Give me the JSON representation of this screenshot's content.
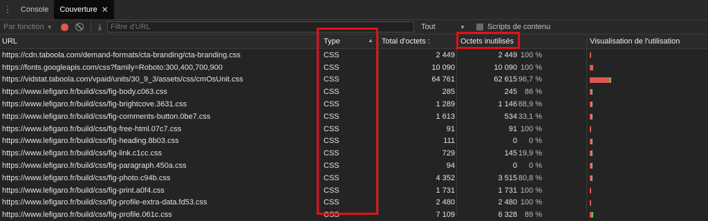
{
  "tabs": [
    {
      "label": "Console",
      "active": false
    },
    {
      "label": "Couverture",
      "active": true
    }
  ],
  "toolbar": {
    "type_select": "Par fonction",
    "filter_placeholder": "Filtre d'URL",
    "scope_select": "Tout",
    "content_scripts_label": "Scripts de contenu"
  },
  "columns": {
    "url": "URL",
    "type": "Type",
    "total": "Total d'octets :",
    "unused": "Octets inutilisés",
    "visualization": "Visualisation de l'utilisation"
  },
  "colors": {
    "unused": "#e0584f",
    "used": "#7bb36a",
    "highlight": "#e2111b"
  },
  "rows": [
    {
      "url": "https://cdn.taboola.com/demand-formats/cta-branding/cta-branding.css",
      "type": "CSS",
      "total": "2 449",
      "unused": "2 449",
      "pct": "100 %",
      "unused_fraction": 1.0,
      "total_bytes": 2449
    },
    {
      "url": "https://fonts.googleapis.com/css?family=Roboto:300,400,700,900",
      "type": "CSS",
      "total": "10 090",
      "unused": "10 090",
      "pct": "100 %",
      "unused_fraction": 1.0,
      "total_bytes": 10090
    },
    {
      "url": "https://vidstat.taboola.com/vpaid/units/30_9_3/assets/css/cmOsUnit.css",
      "type": "CSS",
      "total": "64 761",
      "unused": "62 615",
      "pct": "96,7 %",
      "unused_fraction": 0.967,
      "total_bytes": 64761
    },
    {
      "url": "https://www.lefigaro.fr/build/css/fig-body.c063.css",
      "type": "CSS",
      "total": "285",
      "unused": "245",
      "pct": "86 %",
      "unused_fraction": 0.86,
      "total_bytes": 285
    },
    {
      "url": "https://www.lefigaro.fr/build/css/fig-brightcove.3631.css",
      "type": "CSS",
      "total": "1 289",
      "unused": "1 146",
      "pct": "88,9 %",
      "unused_fraction": 0.889,
      "total_bytes": 1289
    },
    {
      "url": "https://www.lefigaro.fr/build/css/fig-comments-button.0be7.css",
      "type": "CSS",
      "total": "1 613",
      "unused": "534",
      "pct": "33,1 %",
      "unused_fraction": 0.331,
      "total_bytes": 1613
    },
    {
      "url": "https://www.lefigaro.fr/build/css/fig-free-html.07c7.css",
      "type": "CSS",
      "total": "91",
      "unused": "91",
      "pct": "100 %",
      "unused_fraction": 1.0,
      "total_bytes": 91
    },
    {
      "url": "https://www.lefigaro.fr/build/css/fig-heading.8b03.css",
      "type": "CSS",
      "total": "111",
      "unused": "0",
      "pct": "0 %",
      "unused_fraction": 0.0,
      "total_bytes": 111
    },
    {
      "url": "https://www.lefigaro.fr/build/css/fig-link.c1cc.css",
      "type": "CSS",
      "total": "729",
      "unused": "145",
      "pct": "19,9 %",
      "unused_fraction": 0.199,
      "total_bytes": 729
    },
    {
      "url": "https://www.lefigaro.fr/build/css/fig-paragraph.450a.css",
      "type": "CSS",
      "total": "94",
      "unused": "0",
      "pct": "0 %",
      "unused_fraction": 0.0,
      "total_bytes": 94
    },
    {
      "url": "https://www.lefigaro.fr/build/css/fig-photo.c94b.css",
      "type": "CSS",
      "total": "4 352",
      "unused": "3 515",
      "pct": "80,8 %",
      "unused_fraction": 0.808,
      "total_bytes": 4352
    },
    {
      "url": "https://www.lefigaro.fr/build/css/fig-print.a0f4.css",
      "type": "CSS",
      "total": "1 731",
      "unused": "1 731",
      "pct": "100 %",
      "unused_fraction": 1.0,
      "total_bytes": 1731
    },
    {
      "url": "https://www.lefigaro.fr/build/css/fig-profile-extra-data.fd53.css",
      "type": "CSS",
      "total": "2 480",
      "unused": "2 480",
      "pct": "100 %",
      "unused_fraction": 1.0,
      "total_bytes": 2480
    },
    {
      "url": "https://www.lefigaro.fr/build/css/fig-profile.061c.css",
      "type": "CSS",
      "total": "7 109",
      "unused": "6 328",
      "pct": "89 %",
      "unused_fraction": 0.89,
      "total_bytes": 7109
    }
  ]
}
